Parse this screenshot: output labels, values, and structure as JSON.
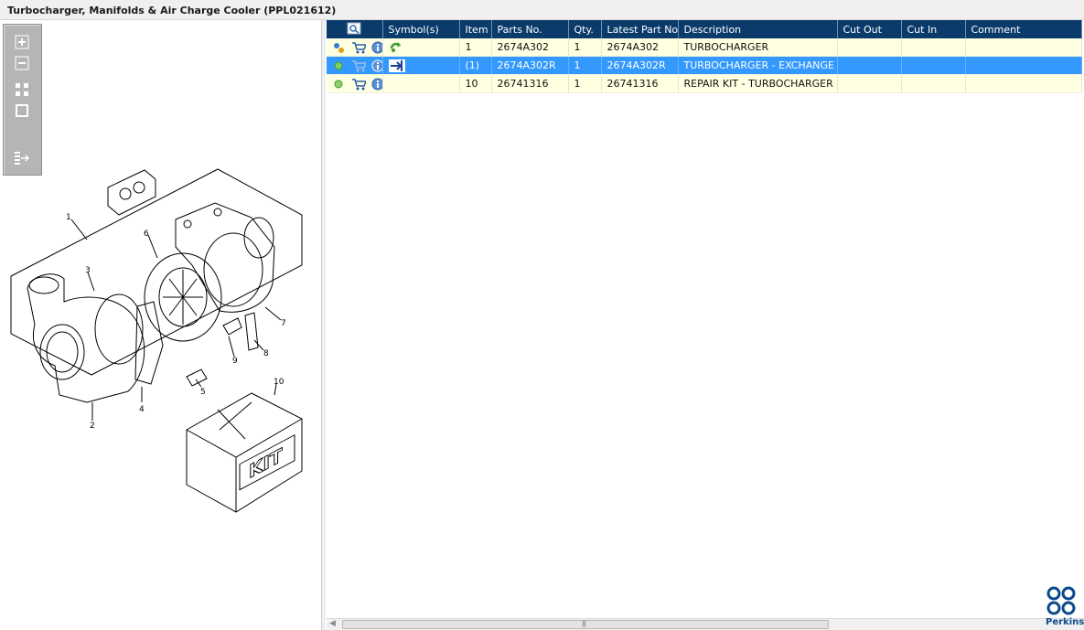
{
  "window": {
    "title": "Turbocharger, Manifolds & Air Charge Cooler (PPL021612)"
  },
  "illustration": {
    "callouts": [
      "1",
      "2",
      "3",
      "4",
      "5",
      "6",
      "7",
      "8",
      "9",
      "10"
    ],
    "kit_label": "KIT"
  },
  "grid": {
    "columns": [
      "",
      "Symbol(s)",
      "Item",
      "Parts No.",
      "Qty.",
      "Latest Part No.",
      "Description",
      "Cut Out",
      "Cut In",
      "Comment"
    ],
    "rows": [
      {
        "item": "1",
        "parts_no": "2674A302",
        "qty": "1",
        "latest_part_no": "2674A302",
        "description": "TURBOCHARGER",
        "cut_out": "",
        "cut_in": "",
        "comment": "",
        "selected": false
      },
      {
        "item": "(1)",
        "parts_no": "2674A302R",
        "qty": "1",
        "latest_part_no": "2674A302R",
        "description": "TURBOCHARGER - EXCHANGE",
        "cut_out": "",
        "cut_in": "",
        "comment": "",
        "selected": true
      },
      {
        "item": "10",
        "parts_no": "26741316",
        "qty": "1",
        "latest_part_no": "26741316",
        "description": "REPAIR KIT - TURBOCHARGER",
        "cut_out": "",
        "cut_in": "",
        "comment": "",
        "selected": false
      }
    ]
  },
  "brand": {
    "name": "Perkins",
    "color": "#0b4a8c"
  },
  "colors": {
    "header": "#0a3b6b",
    "selected_row": "#3399ff",
    "row": "#ffffe1"
  },
  "icons": [
    "zoom-in-icon",
    "zoom-out-icon",
    "fit-icon",
    "reset-icon",
    "export-icon",
    "gears-icon",
    "cart-icon",
    "info-icon",
    "recycle-icon",
    "replace-arrow-icon",
    "find-in-drawing-icon"
  ]
}
